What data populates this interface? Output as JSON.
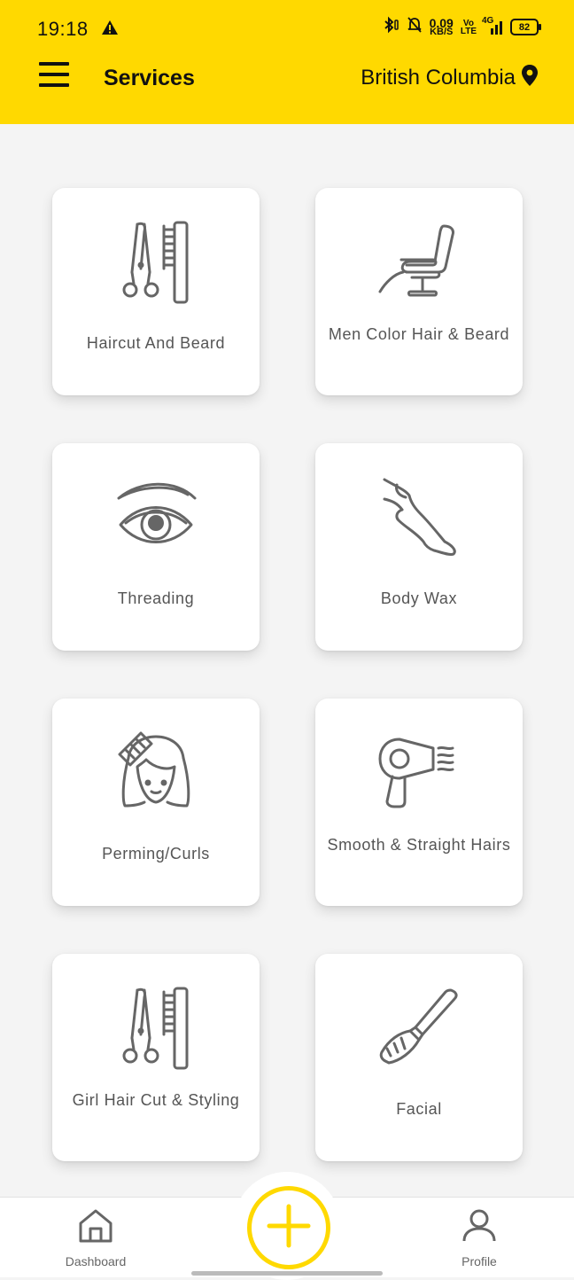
{
  "status_bar": {
    "time": "19:18",
    "net_speed": "0.09",
    "net_unit": "KB/S",
    "volte_top": "Vo",
    "volte_bottom": "LTE",
    "network": "4G",
    "battery": "82"
  },
  "header": {
    "title": "Services",
    "location": "British Columbia"
  },
  "services": [
    {
      "label": "Haircut And Beard",
      "icon": "scissors-comb-icon"
    },
    {
      "label": "Men Color Hair & Beard",
      "icon": "barber-chair-icon"
    },
    {
      "label": "Threading",
      "icon": "eye-brow-icon"
    },
    {
      "label": "Body Wax",
      "icon": "leg-wax-icon"
    },
    {
      "label": "Perming/Curls",
      "icon": "woman-comb-icon"
    },
    {
      "label": "Smooth & Straight Hairs",
      "icon": "hair-dryer-icon"
    },
    {
      "label": "Girl Hair Cut & Styling",
      "icon": "scissors-comb-icon"
    },
    {
      "label": "Facial",
      "icon": "makeup-brush-icon"
    }
  ],
  "bottom_nav": {
    "dashboard": "Dashboard",
    "profile": "Profile"
  },
  "colors": {
    "accent": "#FFD900",
    "icon": "#666666"
  }
}
